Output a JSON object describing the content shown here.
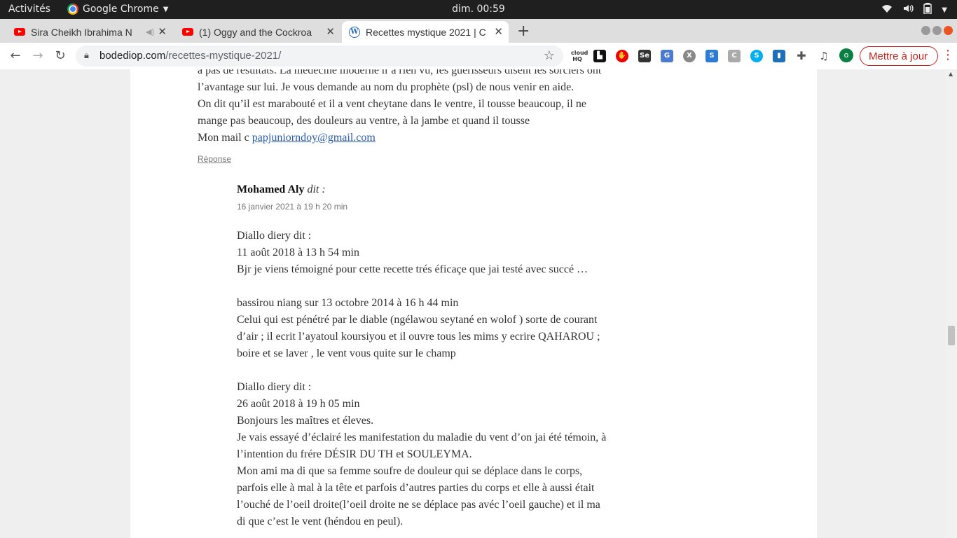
{
  "os_bar": {
    "activities": "Activités",
    "app_name": "Google Chrome",
    "clock": "dim. 00:59"
  },
  "tabs": [
    {
      "label": "Sira Cheikh Ibrahima N",
      "icon": "youtube-icon"
    },
    {
      "label": "(1) Oggy and the Cockroa",
      "icon": "youtube-icon"
    },
    {
      "label": "Recettes mystique 2021 | C",
      "icon": "wordpress-icon"
    }
  ],
  "address_bar": {
    "host": "bodediop.com",
    "path": "/recettes-mystique-2021/"
  },
  "toolbar": {
    "update_label": "Mettre à jour",
    "profile_initial": "o"
  },
  "parent_comment": {
    "lines": [
      "a pas de résultats. La médecine moderne n’a rien vu, les guérisseurs disent les sorciers ont",
      "l’avantage sur lui. Je vous demande au nom du prophète (psl) de nous venir en aide.",
      "On dit qu’il est marabouté et il a vent cheytane dans le ventre, il tousse beaucoup, il ne",
      "mange pas beaucoup, des douleurs au ventre, à la jambe et quand il tousse"
    ],
    "mail_prefix": "Mon mail c ",
    "mail": "papjuniorndoy@gmail.com",
    "reply_label": "Réponse"
  },
  "child_comment": {
    "author": "Mohamed Aly",
    "says": "dit :",
    "date": "16 janvier 2021 à 19 h 20 min",
    "block1": [
      "Diallo diery dit :",
      "11 août 2018 à 13 h 54 min",
      "Bjr je viens témoigné pour cette recette trés éficaçe que jai testé avec succé …"
    ],
    "block2": [
      "bassirou niang sur 13 octobre 2014 à 16 h 44 min",
      "Celui qui est pénétré par le diable (ngélawou seytané en wolof ) sorte de courant",
      "d’air ; il ecrit l’ayatoul koursiyou et il ouvre tous les mims y ecrire QAHAROU ;",
      "boire et se laver , le vent vous quite sur le champ"
    ],
    "block3": [
      "Diallo diery dit :",
      "26 août 2018 à 19 h 05 min",
      "Bonjours les maîtres et éleves.",
      "Je vais essayé d’éclairé les manifestation du maladie du vent d’on jai été témoin, à",
      "l’intention du frére DÉSIR DU TH et SOULEYMA.",
      "Mon ami ma di que sa femme soufre de douleur qui se déplace dans le corps,",
      "parfois elle à mal à la tête et parfois d’autres parties du corps et elle à aussi était",
      "l’ouché de l’oeil droite(l’oeil droite ne se déplace pas avéc l’oeil gauche) et il ma",
      "di que c’est le vent (héndou en peul)."
    ]
  }
}
